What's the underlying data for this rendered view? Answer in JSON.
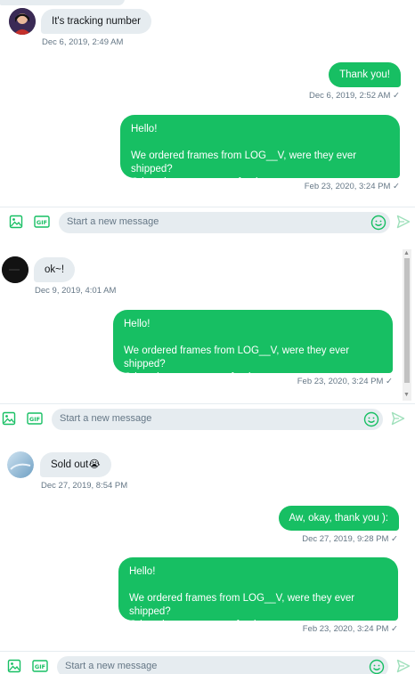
{
  "threads": [
    {
      "received": {
        "text": "It's tracking number",
        "time": "Dec 6, 2019, 2:49 AM"
      },
      "reply": {
        "text": "Thank you!",
        "time": "Dec 6, 2019, 2:52 AM",
        "check": "✓"
      },
      "message": {
        "line1": "Hello!",
        "line2": "We ordered frames from LOG__V, were they ever shipped?",
        "line3": "Otherwise we want a refund.",
        "time": "Feb 23, 2020, 3:24 PM",
        "check": "✓"
      },
      "composer": {
        "placeholder": "Start a new message",
        "gif_label": "GIF"
      }
    },
    {
      "received": {
        "text": "ok~!",
        "time": "Dec 9, 2019, 4:01 AM"
      },
      "message": {
        "line1": "Hello!",
        "line2": "We ordered frames from LOG__V, were they ever shipped?",
        "line3": "Otherwise we want a refund.",
        "time": "Feb 23, 2020, 3:24 PM",
        "check": "✓"
      },
      "composer": {
        "placeholder": "Start a new message",
        "gif_label": "GIF"
      },
      "scrollbar": {
        "up": "▲",
        "down": "▼"
      }
    },
    {
      "received": {
        "text": "Sold out😭",
        "time": "Dec 27, 2019, 8:54 PM"
      },
      "reply": {
        "text": "Aw, okay, thank you ):",
        "time": "Dec 27, 2019, 9:28 PM",
        "check": "✓"
      },
      "message": {
        "line1": "Hello!",
        "line2": "We ordered frames from LOG__V, were they ever shipped?",
        "line3": "Otherwise we want a refund.",
        "time": "Feb 23, 2020, 3:24 PM",
        "check": "✓"
      },
      "composer": {
        "placeholder": "Start a new message",
        "gif_label": "GIF"
      }
    }
  ],
  "colors": {
    "accent": "#17bf63",
    "bubble_in": "#e6ecf0",
    "muted": "#657786"
  },
  "icons": [
    "image-icon",
    "gif-icon",
    "emoji-icon",
    "send-icon"
  ]
}
